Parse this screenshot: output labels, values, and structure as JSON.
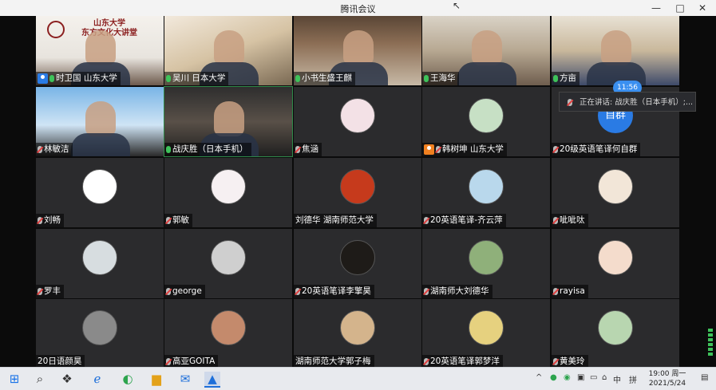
{
  "window": {
    "title": "腾讯会议",
    "controls": [
      "—",
      "□",
      "✕"
    ]
  },
  "tiles": [
    {
      "name": "时卫国  山东大学",
      "host": "blue",
      "mic": "on",
      "video": "lecture"
    },
    {
      "name": "吴川 日本大学",
      "mic": "on",
      "video": "office2"
    },
    {
      "name": "小书生盛王麒",
      "mic": "on",
      "video": "library"
    },
    {
      "name": "王海华",
      "mic": "on",
      "video": "shelf"
    },
    {
      "name": "方亩",
      "mic": "on",
      "video": "shelf2"
    },
    {
      "name": "林敏洁",
      "mic": "off",
      "video": "sky"
    },
    {
      "name": "战庆胜（日本手机）",
      "mic": "on",
      "video": "room",
      "active": true
    },
    {
      "name": "焦涵",
      "mic": "off",
      "avatar": "a1"
    },
    {
      "name": "韩树坤  山东大学",
      "host": "orange",
      "mic": "off",
      "avatar": "a2"
    },
    {
      "name": "20级英语笔译何自群",
      "mic": "off",
      "avatar": "text",
      "avatar_text": "自群"
    },
    {
      "name": "刘畅",
      "mic": "off",
      "avatar": "a3"
    },
    {
      "name": "郭敏",
      "mic": "off",
      "avatar": "a4"
    },
    {
      "name": "刘德华 湖南师范大学",
      "mic": "none",
      "avatar": "a5"
    },
    {
      "name": "20英语笔译-齐云萍",
      "mic": "off",
      "avatar": "a6"
    },
    {
      "name": "呲呲呔",
      "mic": "off",
      "avatar": "a7"
    },
    {
      "name": "罗丰",
      "mic": "off",
      "avatar": "a8"
    },
    {
      "name": "george",
      "mic": "off",
      "avatar": "a9"
    },
    {
      "name": "20英语笔译李擎昊",
      "mic": "off",
      "avatar": "a10"
    },
    {
      "name": "湖南师大刘德华",
      "mic": "off",
      "avatar": "a11"
    },
    {
      "name": "rayisa",
      "mic": "off",
      "avatar": "a12"
    },
    {
      "name": "20日语颜昊",
      "mic": "none",
      "avatar": "a13"
    },
    {
      "name": "高亚GOITA",
      "mic": "off",
      "avatar": "a14"
    },
    {
      "name": "湖南师范大学郭子梅",
      "mic": "none",
      "avatar": "a15"
    },
    {
      "name": "20英语笔译郭梦洋",
      "mic": "off",
      "avatar": "a16"
    },
    {
      "name": "黄美玲",
      "mic": "off",
      "avatar": "a17"
    }
  ],
  "overlay": {
    "time_badge": "11:56",
    "speaking": "正在讲话: 战庆胜（日本手机）;..."
  },
  "banner": {
    "line1": "山东大学",
    "line2": "东方文化大讲堂"
  },
  "taskbar": {
    "icons": [
      "windows-icon",
      "search-icon",
      "taskview-icon",
      "edge-icon",
      "edge-new-icon",
      "explorer-icon",
      "mail-icon",
      "meeting-icon"
    ],
    "tray": {
      "up": "^",
      "ime": "中",
      "lang": "拼"
    },
    "clock": {
      "time": "19:00 周一",
      "date": "2021/5/24"
    }
  },
  "colors": {
    "accent": "#2a7be4",
    "mic_on": "#3ec25a",
    "tile_bg": "#2b2b2d"
  }
}
